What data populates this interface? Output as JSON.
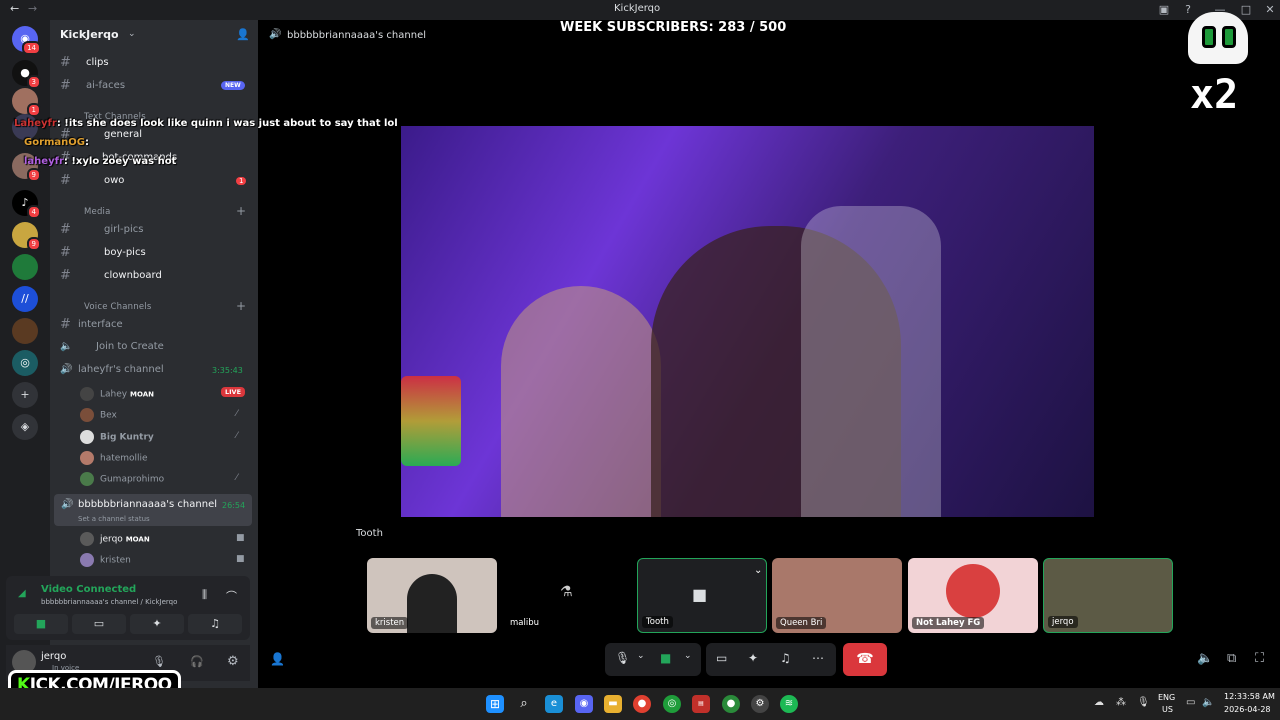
{
  "window": {
    "title": "KickJerqo"
  },
  "overlay_top": "WEEK SUBSCRIBERS: 283 / 500",
  "overlay_multiplier": "x2",
  "server": {
    "name": "KickJerqo"
  },
  "servers": [
    {
      "icon": "discord-icon",
      "badge": "14"
    },
    {
      "icon": "server-avatar",
      "badge": "3"
    },
    {
      "icon": "server-avatar",
      "badge": "1"
    },
    {
      "icon": "server-avatar",
      "badge": ""
    },
    {
      "icon": "server-avatar",
      "badge": "9"
    },
    {
      "icon": "tiktok-icon",
      "badge": "4"
    },
    {
      "icon": "server-avatar",
      "badge": "9"
    },
    {
      "icon": "server-avatar",
      "badge": ""
    },
    {
      "icon": "server-avatar",
      "badge": ""
    },
    {
      "icon": "server-avatar",
      "badge": ""
    },
    {
      "icon": "server-avatar",
      "badge": ""
    }
  ],
  "channels": {
    "clips": "clips",
    "ai_faces": "ai-faces",
    "ai_faces_badge": "NEW",
    "text_category": "Text Channels",
    "general": "general",
    "bot_commands": "bot-commands",
    "owo": "owo",
    "owo_badge": "1",
    "media_category": "Media",
    "girl_pics": "girl-pics",
    "boy_pics": "boy-pics",
    "clownboard": "clownboard",
    "voice_category": "Voice Channels",
    "interface": "interface",
    "join_to_create": "Join to Create",
    "laheyfr_channel": "laheyfr's channel",
    "laheyfr_time": "3:35:43",
    "b_channel": "bbbbbbriannaaaa's channel",
    "b_channel_time": "26:54",
    "b_channel_status": "Set a channel status"
  },
  "voice_users_lahey": [
    {
      "name": "Lahey",
      "tag": "MOAN",
      "live": "LIVE"
    },
    {
      "name": "Bex",
      "tag": "",
      "live": ""
    },
    {
      "name": "Big Kuntry",
      "tag": "",
      "live": ""
    },
    {
      "name": "hatemollie",
      "tag": "",
      "live": ""
    },
    {
      "name": "Gumaprohimo",
      "tag": "",
      "live": ""
    }
  ],
  "voice_users_b": [
    {
      "name": "jerqo",
      "tag": "MOAN"
    },
    {
      "name": "kristen",
      "tag": ""
    }
  ],
  "chat_overlay": [
    {
      "user": "Laheyfr",
      "text": ": !its she does look like quinn i was just about to say that lol"
    },
    {
      "user": "GormanOG",
      "text": ":"
    },
    {
      "user": "laheyfr",
      "text": ": !xylo zoey was hot"
    }
  ],
  "voice_connection": {
    "status": "Video Connected",
    "detail": "bbbbbbriannaaaa's channel / KickJerqo"
  },
  "current_user": {
    "name": "jerqo",
    "status": "In voice"
  },
  "stage": {
    "channel_name": "bbbbbbriannaaaa's channel",
    "focused_label": "Tooth"
  },
  "tiles": [
    {
      "name": "kristen",
      "selected": false
    },
    {
      "name": "malibu",
      "selected": false
    },
    {
      "name": "Tooth",
      "selected": true
    },
    {
      "name": "Queen Bri",
      "selected": false
    },
    {
      "name": "Not Lahey FG",
      "selected": false
    },
    {
      "name": "jerqo",
      "selected": true
    }
  ],
  "watermark": {
    "prefix": "K",
    "text": "ICK.COM/JERQO"
  },
  "taskbar": {
    "lang_top": "ENG",
    "lang_bottom": "US",
    "time": "12:33:58 AM",
    "date": "2026-04-28"
  },
  "colors": {
    "accent": "#5865f2",
    "danger": "#da373c",
    "online": "#23a55a",
    "kick_green": "#53fc18"
  }
}
